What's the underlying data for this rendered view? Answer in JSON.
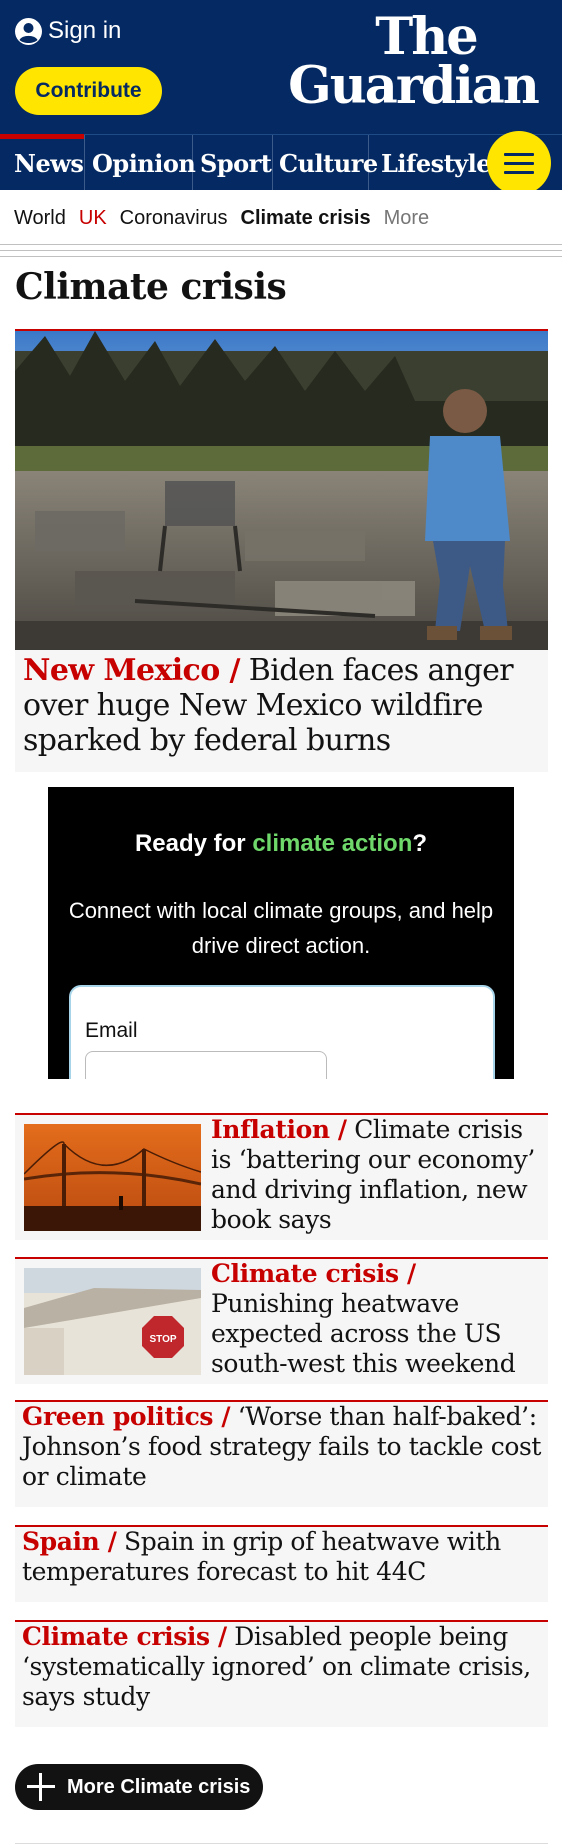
{
  "header": {
    "sign_in": "Sign in",
    "contribute": "Contribute",
    "logo_line1": "The",
    "logo_line2": "Guardian",
    "colors": {
      "brand": "#052962",
      "accent": "#ffe500",
      "news_red": "#c70000"
    }
  },
  "pillars": [
    {
      "label": "News",
      "active": true
    },
    {
      "label": "Opinion"
    },
    {
      "label": "Sport"
    },
    {
      "label": "Culture"
    },
    {
      "label": "Lifestyle"
    }
  ],
  "menu_icon": "hamburger-menu-icon",
  "subnav": {
    "items": [
      "World",
      "UK",
      "Coronavirus",
      "Climate crisis",
      "More"
    ]
  },
  "section_title": "Climate crisis",
  "lead": {
    "kicker": "New Mexico /",
    "headline": "Biden faces anger over huge New Mexico wildfire sparked by federal burns"
  },
  "ad": {
    "title_prefix": "Ready for ",
    "title_highlight": "climate action",
    "title_suffix": "?",
    "body": "Connect with local climate groups, and help drive direct action.",
    "email_label": "Email"
  },
  "stories": [
    {
      "kicker": "Inflation /",
      "headline": "Climate crisis is ‘battering our economy’ and driving inflation, new book says"
    },
    {
      "kicker": "Climate crisis /",
      "headline": "Punishing heatwave expected across the US south-west this weekend"
    },
    {
      "kicker": "Green politics /",
      "headline": "‘Worse than half-baked’: Johnson’s food strategy fails to tackle cost or climate"
    },
    {
      "kicker": "Spain /",
      "headline": "Spain in grip of heatwave with temperatures forecast to hit 44C"
    },
    {
      "kicker": "Climate crisis /",
      "headline": "Disabled people being ‘systematically ignored’ on climate crisis, says study"
    }
  ],
  "more_button": "More Climate crisis"
}
